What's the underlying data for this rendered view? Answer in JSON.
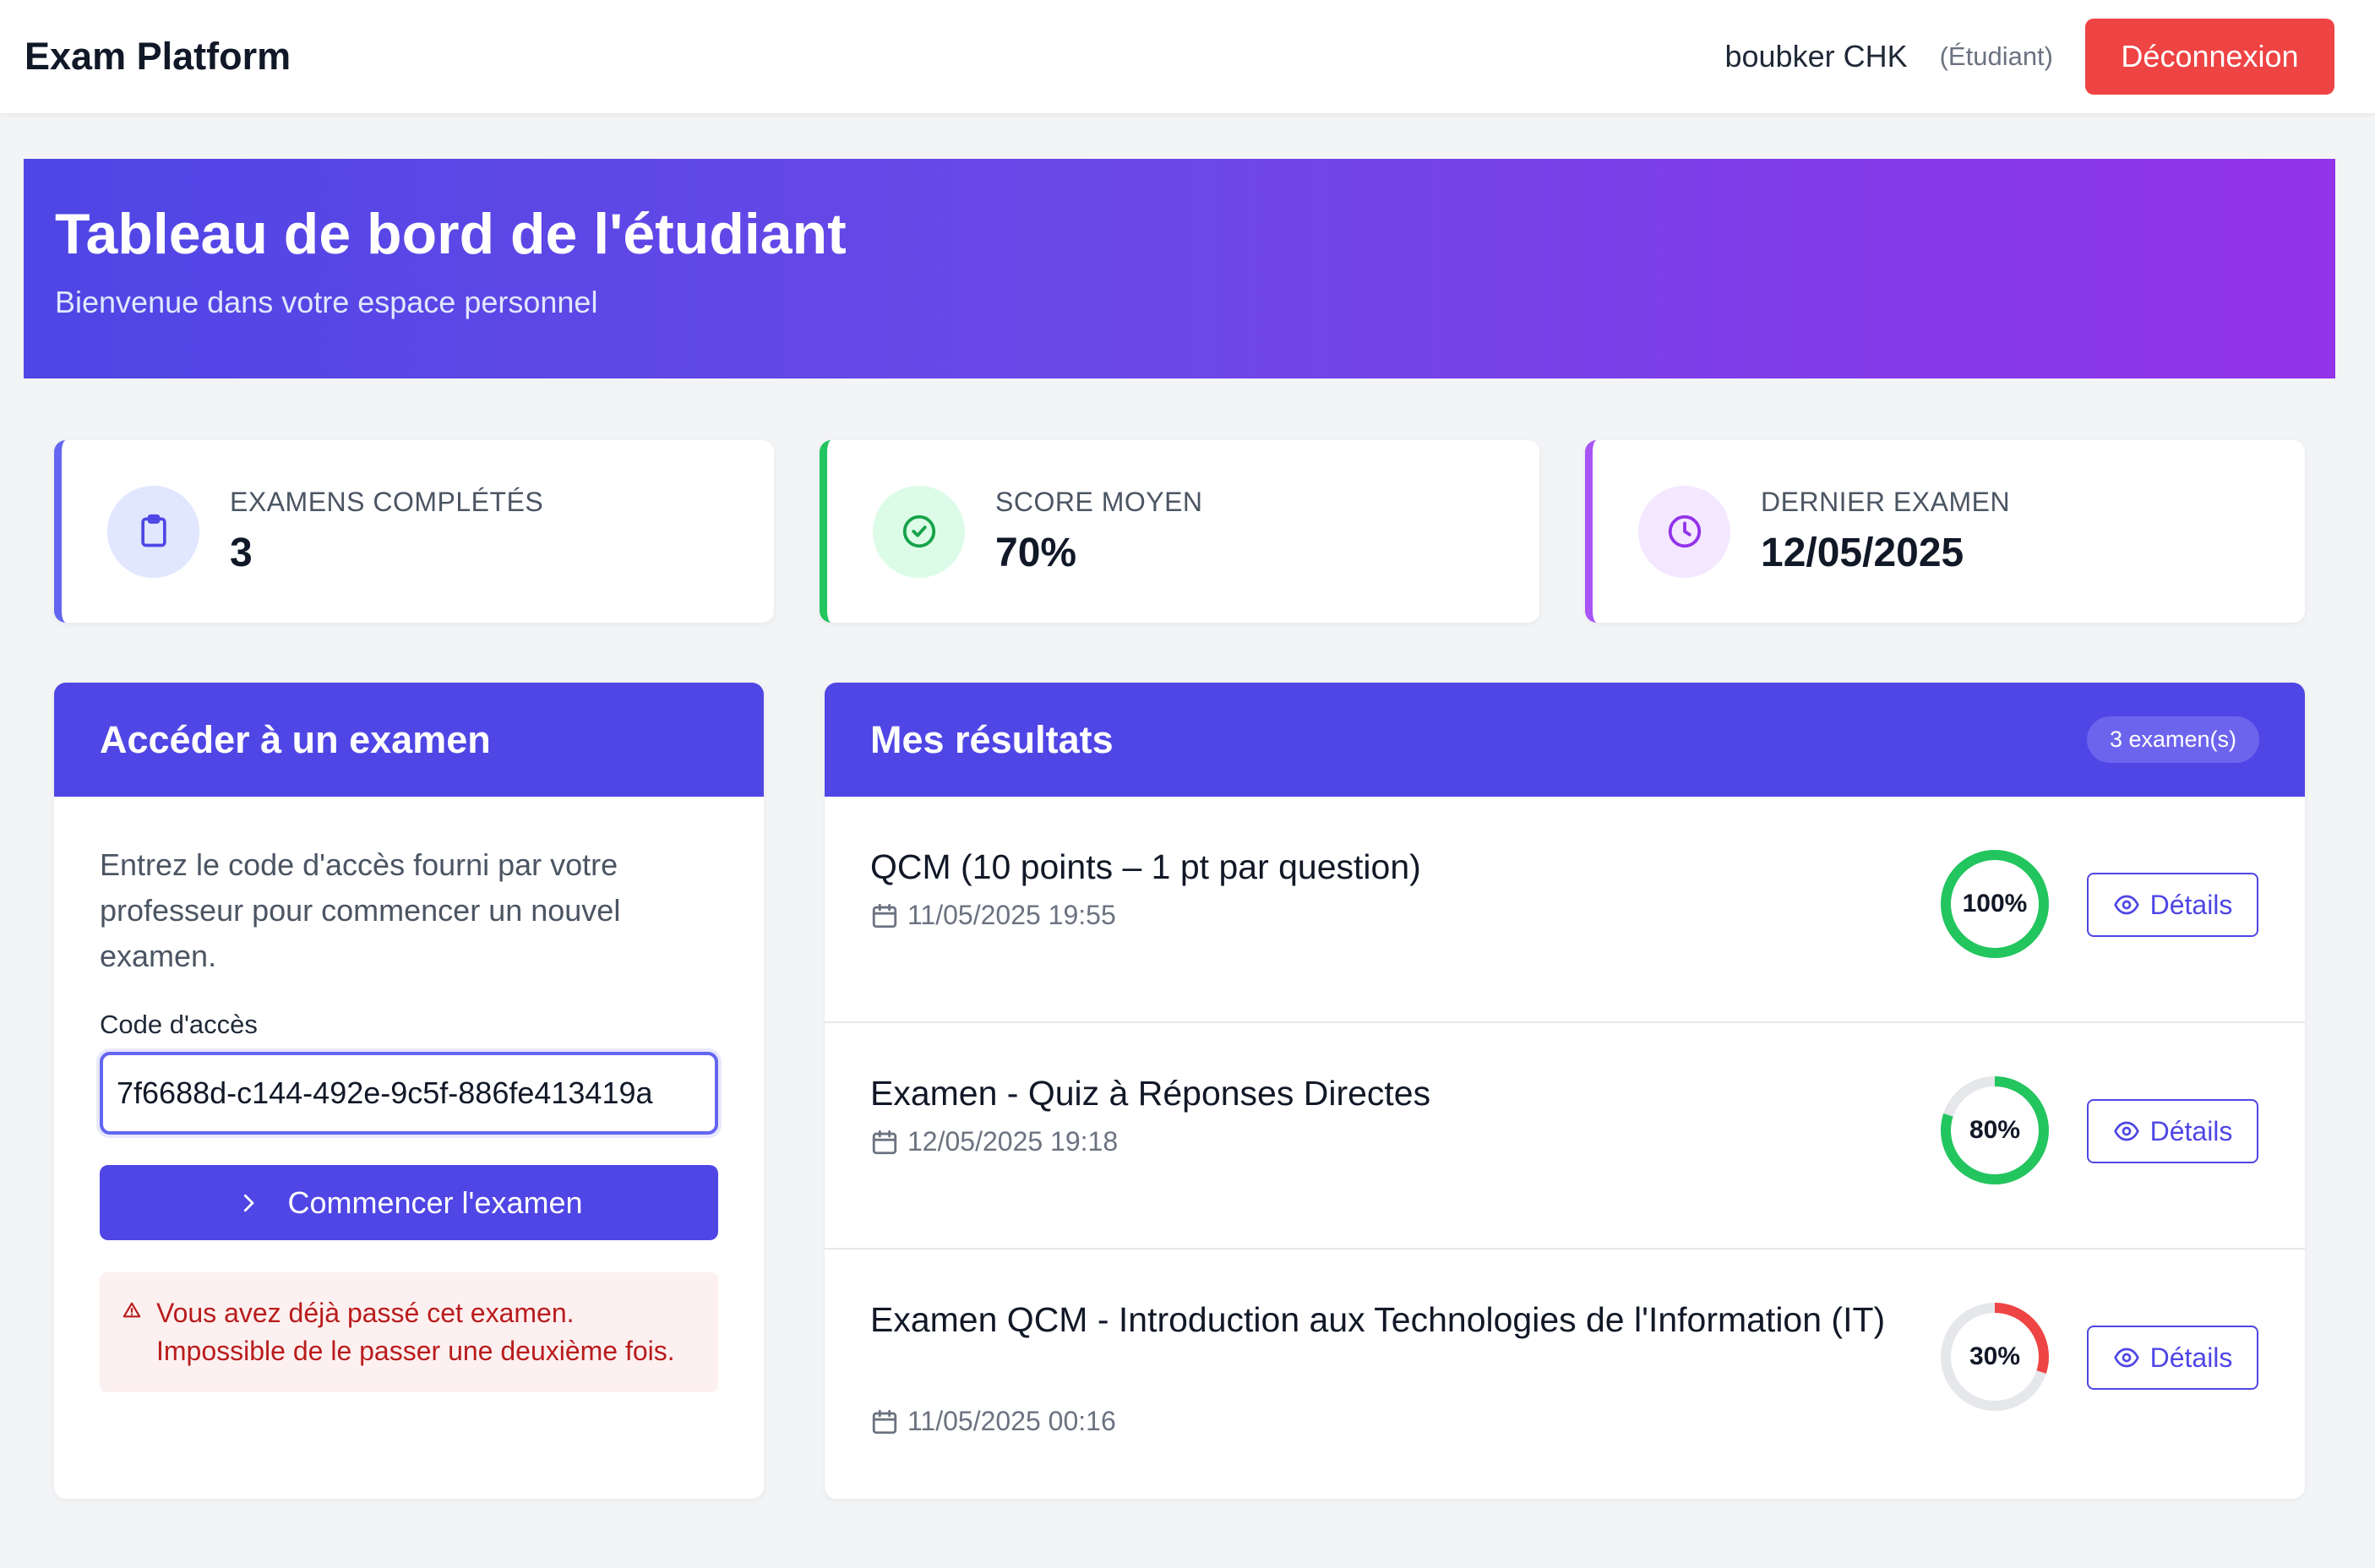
{
  "navbar": {
    "brand": "Exam Platform",
    "username": "boubker CHK",
    "role": "(Étudiant)",
    "logout_label": "Déconnexion"
  },
  "hero": {
    "title": "Tableau de bord de l'étudiant",
    "subtitle": "Bienvenue dans votre espace personnel"
  },
  "stats": [
    {
      "label": "EXAMENS COMPLÉTÉS",
      "value": "3",
      "icon": "clipboard-icon"
    },
    {
      "label": "SCORE MOYEN",
      "value": "70%",
      "icon": "check-circle-icon"
    },
    {
      "label": "DERNIER EXAMEN",
      "value": "12/05/2025",
      "icon": "clock-icon"
    }
  ],
  "access": {
    "title": "Accéder à un examen",
    "intro": "Entrez le code d'accès fourni par votre professeur pour commencer un nouvel examen.",
    "code_label": "Code d'accès",
    "code_value": "7f6688d-c144-492e-9c5f-886fe413419a",
    "start_label": "Commencer l'examen",
    "alert": "Vous avez déjà passé cet examen. Impossible de le passer une deuxième fois."
  },
  "results": {
    "title": "Mes résultats",
    "count_badge": "3 examen(s)",
    "details_label": "Détails",
    "items": [
      {
        "title": "QCM (10 points – 1 pt par question)",
        "date": "11/05/2025 19:55",
        "score": 100,
        "score_label": "100%",
        "color": "#22c55e"
      },
      {
        "title": "Examen - Quiz à Réponses Directes",
        "date": "12/05/2025 19:18",
        "score": 80,
        "score_label": "80%",
        "color": "#22c55e"
      },
      {
        "title": "Examen QCM - Introduction aux Technologies de l'Information (IT)",
        "date": "11/05/2025 00:16",
        "score": 30,
        "score_label": "30%",
        "color": "#ef4444"
      }
    ]
  },
  "colors": {
    "primary": "#5046e5",
    "danger": "#ef4444",
    "success": "#22c55e",
    "purple": "#a855f7"
  }
}
